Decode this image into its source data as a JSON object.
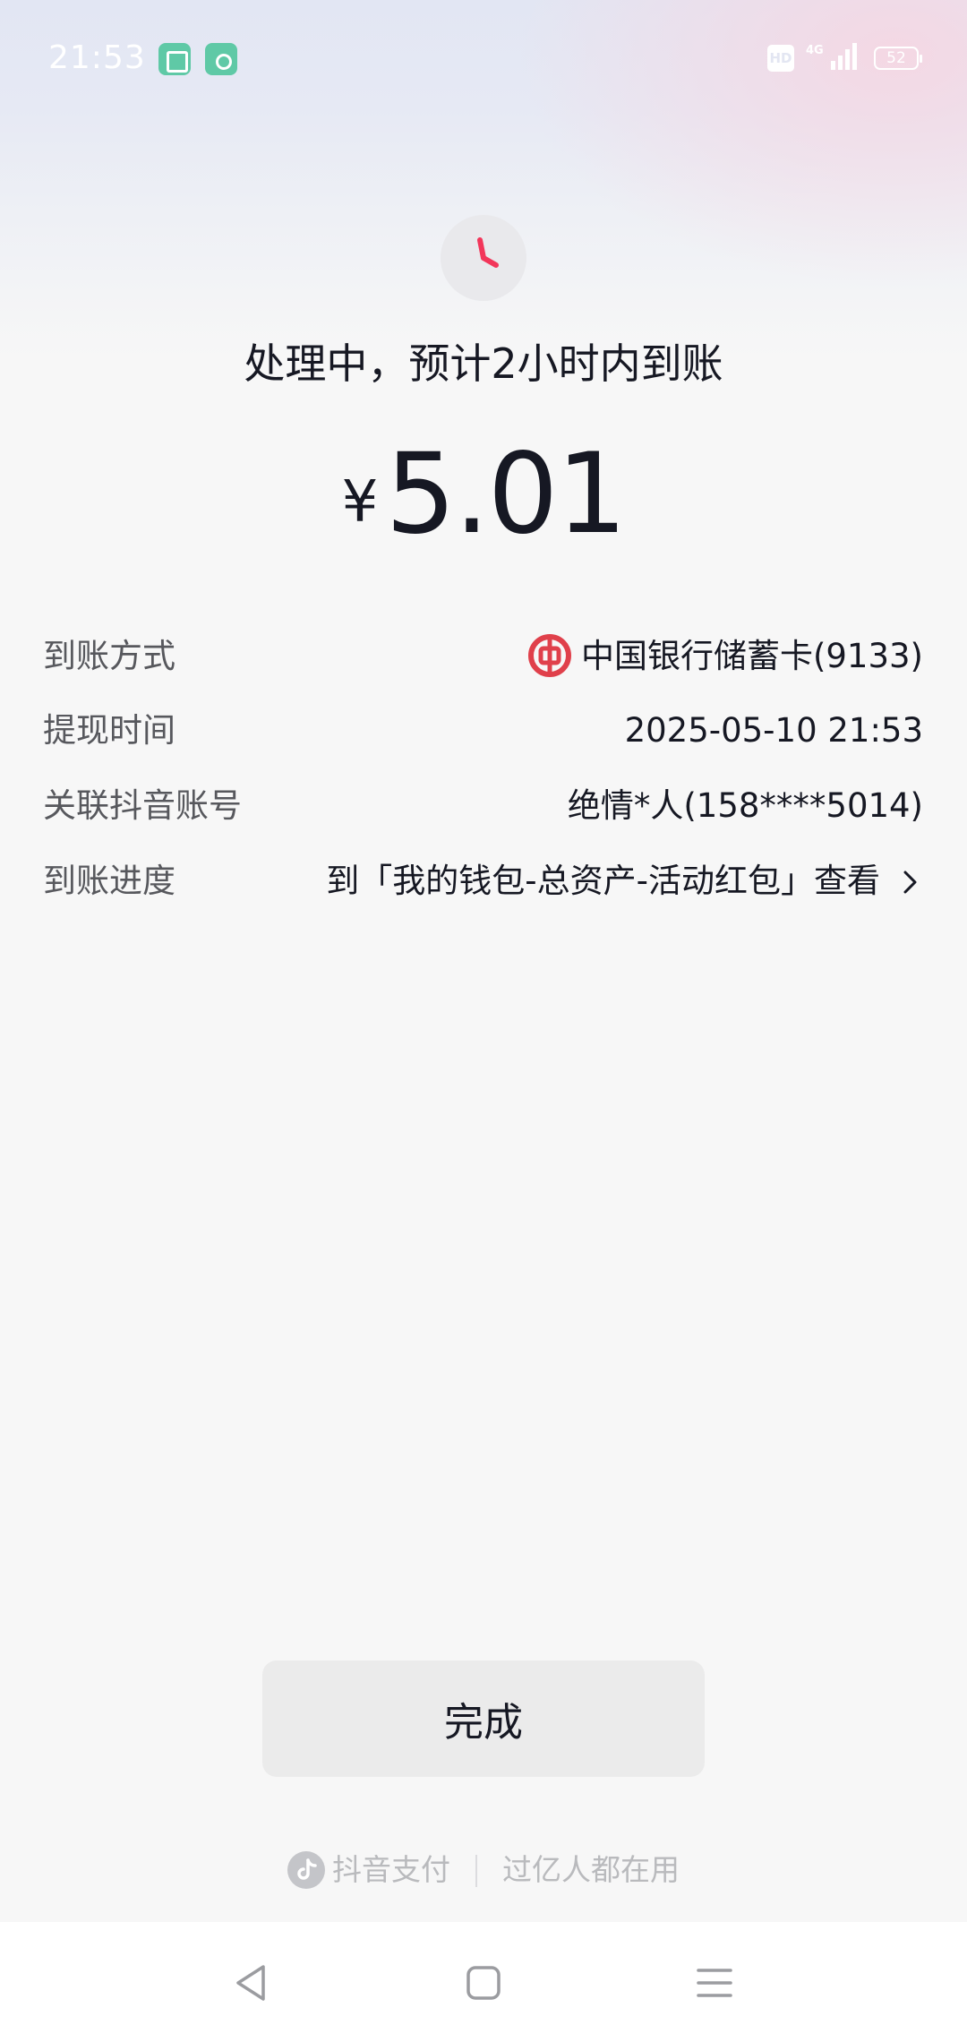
{
  "status_bar": {
    "time": "21:53",
    "hd": "HD",
    "network": "4G",
    "battery": "52"
  },
  "status": {
    "icon": "clock-icon",
    "text": "处理中，预计2小时内到账"
  },
  "amount": {
    "currency": "¥",
    "value": "5.01"
  },
  "details": [
    {
      "label": "到账方式",
      "value": "中国银行储蓄卡(9133)",
      "icon": "bank-of-china-logo"
    },
    {
      "label": "提现时间",
      "value": "2025-05-10 21:53"
    },
    {
      "label": "关联抖音账号",
      "value": "绝情*人(158****5014)"
    },
    {
      "label": "到账进度",
      "value": "到「我的钱包-总资产-活动红包」查看",
      "icon": "chevron-right-icon"
    }
  ],
  "done_button": "完成",
  "footer": {
    "brand": "抖音支付",
    "slogan": "过亿人都在用"
  },
  "colors": {
    "clock_hand": "#f2365a",
    "bank_logo": "#e0404b",
    "text_primary": "#161823",
    "text_secondary": "#57585d"
  }
}
